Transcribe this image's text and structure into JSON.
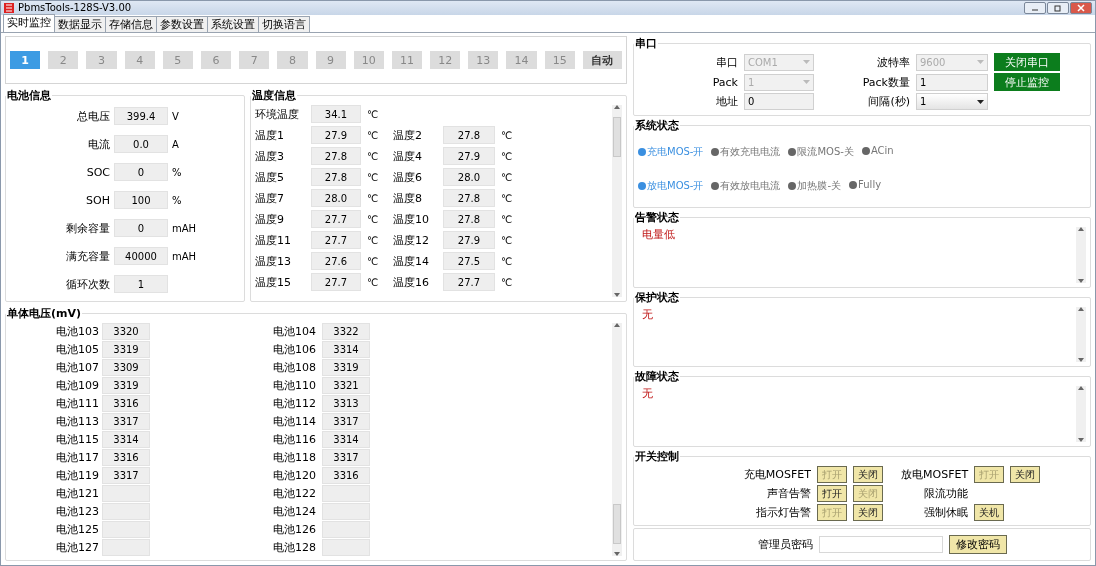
{
  "window": {
    "title": "PbmsTools-128S-V3.00"
  },
  "tabs": [
    {
      "label": "实时监控",
      "selected": true
    },
    {
      "label": "数据显示",
      "selected": false
    },
    {
      "label": "存储信息",
      "selected": false
    },
    {
      "label": "参数设置",
      "selected": false
    },
    {
      "label": "系统设置",
      "selected": false
    },
    {
      "label": "切换语言",
      "selected": false
    }
  ],
  "pack_selector": [
    {
      "label": "1",
      "selected": true
    },
    {
      "label": "2",
      "selected": false
    },
    {
      "label": "3",
      "selected": false
    },
    {
      "label": "4",
      "selected": false
    },
    {
      "label": "5",
      "selected": false
    },
    {
      "label": "6",
      "selected": false
    },
    {
      "label": "7",
      "selected": false
    },
    {
      "label": "8",
      "selected": false
    },
    {
      "label": "9",
      "selected": false
    },
    {
      "label": "10",
      "selected": false
    },
    {
      "label": "11",
      "selected": false
    },
    {
      "label": "12",
      "selected": false
    },
    {
      "label": "13",
      "selected": false
    },
    {
      "label": "14",
      "selected": false
    },
    {
      "label": "15",
      "selected": false
    },
    {
      "label": "自动",
      "selected": false
    }
  ],
  "battery_info": {
    "title": "电池信息",
    "fields": [
      {
        "label": "总电压",
        "value": "399.4",
        "unit": "V"
      },
      {
        "label": "电流",
        "value": "0.0",
        "unit": "A"
      },
      {
        "label": "SOC",
        "value": "0",
        "unit": "%"
      },
      {
        "label": "SOH",
        "value": "100",
        "unit": "%"
      },
      {
        "label": "剩余容量",
        "value": "0",
        "unit": "mAH"
      },
      {
        "label": "满充容量",
        "value": "40000",
        "unit": "mAH"
      },
      {
        "label": "循环次数",
        "value": "1"
      }
    ]
  },
  "temperature_info": {
    "title": "温度信息",
    "ambient": {
      "label": "环境温度",
      "value": "34.1",
      "unit": "℃"
    },
    "sensors": [
      {
        "label": "温度1",
        "value": "27.9",
        "unit": "℃"
      },
      {
        "label": "温度2",
        "value": "27.8",
        "unit": "℃"
      },
      {
        "label": "温度3",
        "value": "27.8",
        "unit": "℃"
      },
      {
        "label": "温度4",
        "value": "27.9",
        "unit": "℃"
      },
      {
        "label": "温度5",
        "value": "27.8",
        "unit": "℃"
      },
      {
        "label": "温度6",
        "value": "28.0",
        "unit": "℃"
      },
      {
        "label": "温度7",
        "value": "28.0",
        "unit": "℃"
      },
      {
        "label": "温度8",
        "value": "27.8",
        "unit": "℃"
      },
      {
        "label": "温度9",
        "value": "27.7",
        "unit": "℃"
      },
      {
        "label": "温度10",
        "value": "27.8",
        "unit": "℃"
      },
      {
        "label": "温度11",
        "value": "27.7",
        "unit": "℃"
      },
      {
        "label": "温度12",
        "value": "27.9",
        "unit": "℃"
      },
      {
        "label": "温度13",
        "value": "27.6",
        "unit": "℃"
      },
      {
        "label": "温度14",
        "value": "27.5",
        "unit": "℃"
      },
      {
        "label": "温度15",
        "value": "27.7",
        "unit": "℃"
      },
      {
        "label": "温度16",
        "value": "27.7",
        "unit": "℃"
      }
    ]
  },
  "cell_voltages": {
    "title": "单体电压(mV)",
    "cells": [
      {
        "label": "电池103",
        "value": "3320"
      },
      {
        "label": "电池104",
        "value": "3322"
      },
      {
        "label": "电池105",
        "value": "3319"
      },
      {
        "label": "电池106",
        "value": "3314"
      },
      {
        "label": "电池107",
        "value": "3309"
      },
      {
        "label": "电池108",
        "value": "3319"
      },
      {
        "label": "电池109",
        "value": "3319"
      },
      {
        "label": "电池110",
        "value": "3321"
      },
      {
        "label": "电池111",
        "value": "3316"
      },
      {
        "label": "电池112",
        "value": "3313"
      },
      {
        "label": "电池113",
        "value": "3317"
      },
      {
        "label": "电池114",
        "value": "3317"
      },
      {
        "label": "电池115",
        "value": "3314"
      },
      {
        "label": "电池116",
        "value": "3314"
      },
      {
        "label": "电池117",
        "value": "3316"
      },
      {
        "label": "电池118",
        "value": "3317"
      },
      {
        "label": "电池119",
        "value": "3317"
      },
      {
        "label": "电池120",
        "value": "3316"
      },
      {
        "label": "电池121"
      },
      {
        "label": "电池122"
      },
      {
        "label": "电池123"
      },
      {
        "label": "电池124"
      },
      {
        "label": "电池125"
      },
      {
        "label": "电池126"
      },
      {
        "label": "电池127"
      },
      {
        "label": "电池128"
      }
    ]
  },
  "serial_port": {
    "title": "串口",
    "fields": [
      {
        "label": "串口",
        "value": "COM1",
        "kind": "select",
        "disabled": true
      },
      {
        "label": "波特率",
        "value": "9600",
        "kind": "select",
        "disabled": true
      },
      {
        "label": "Pack",
        "value": "1",
        "kind": "select",
        "disabled": true
      },
      {
        "label": "Pack数量",
        "value": "1",
        "kind": "text",
        "disabled": false
      },
      {
        "label": "地址",
        "value": "0",
        "kind": "text",
        "disabled": false
      },
      {
        "label": "间隔(秒)",
        "value": "1",
        "kind": "select",
        "disabled": false
      }
    ],
    "buttons": [
      "关闭串口",
      "停止监控"
    ]
  },
  "system_status": {
    "title": "系统状态",
    "rows": [
      [
        {
          "label": "充电MOS-开",
          "on": true
        },
        {
          "label": "有效充电电流",
          "on": false
        },
        {
          "label": "限流MOS-关",
          "on": false
        },
        {
          "label": "ACin",
          "on": false
        }
      ],
      [
        {
          "label": "放电MOS-开",
          "on": true
        },
        {
          "label": "有效放电电流",
          "on": false
        },
        {
          "label": "加热膜-关",
          "on": false
        },
        {
          "label": "Fully",
          "on": false
        }
      ]
    ]
  },
  "alarm_status": {
    "title": "告警状态",
    "lines": [
      "电量低"
    ]
  },
  "protection_status": {
    "title": "保护状态",
    "lines": [
      "无"
    ]
  },
  "fault_status": {
    "title": "故障状态",
    "lines": [
      "无"
    ]
  },
  "switch_control": {
    "title": "开关控制",
    "left": [
      {
        "label": "充电MOSFET",
        "buttons": [
          {
            "label": "打开",
            "disabled": true
          },
          {
            "label": "关闭",
            "disabled": false
          }
        ]
      },
      {
        "label": "声音告警",
        "buttons": [
          {
            "label": "打开",
            "disabled": false
          },
          {
            "label": "关闭",
            "disabled": true
          }
        ]
      },
      {
        "label": "指示灯告警",
        "buttons": [
          {
            "label": "打开",
            "disabled": true
          },
          {
            "label": "关闭",
            "disabled": false
          }
        ]
      }
    ],
    "right": [
      {
        "label": "放电MOSFET",
        "buttons": [
          {
            "label": "打开",
            "disabled": true
          },
          {
            "label": "关闭",
            "disabled": false
          }
        ]
      },
      {
        "label": "限流功能"
      },
      {
        "label": "强制休眠",
        "buttons": [
          {
            "label": "关机",
            "disabled": false
          }
        ]
      }
    ]
  },
  "admin": {
    "label": "管理员密码",
    "button": "修改密码"
  }
}
